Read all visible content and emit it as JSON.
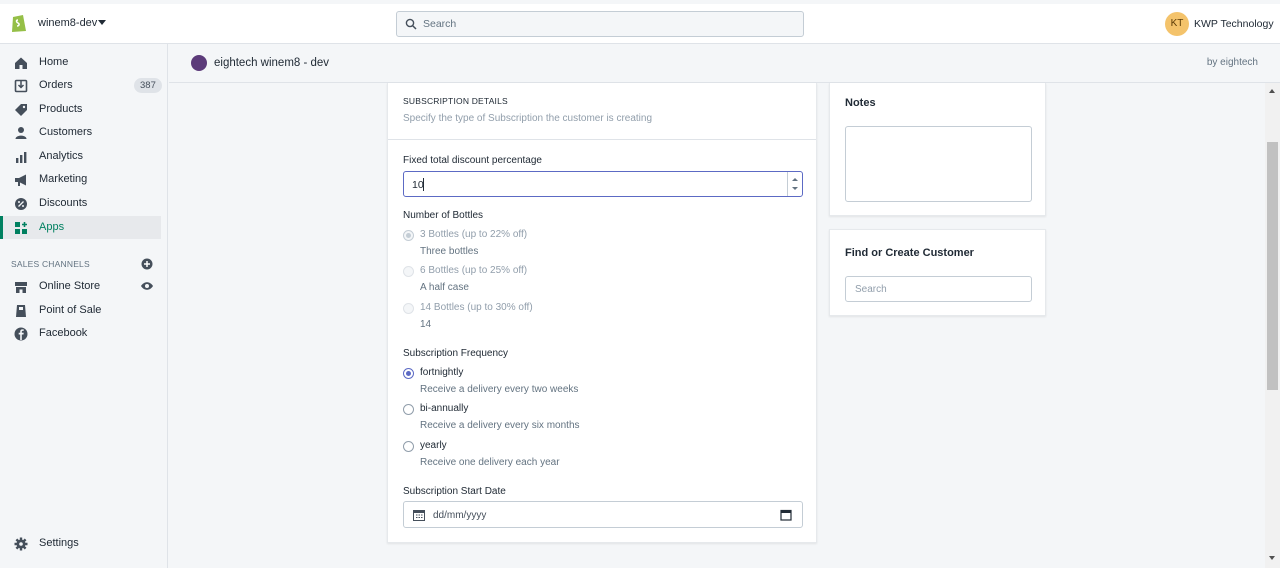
{
  "topbar": {
    "store_name": "winem8-dev",
    "search_placeholder": "Search",
    "avatar_initials": "KT",
    "account_name": "KWP Technology"
  },
  "sidebar": {
    "items": [
      {
        "label": "Home",
        "icon": "home-icon"
      },
      {
        "label": "Orders",
        "icon": "orders-icon",
        "badge": "387"
      },
      {
        "label": "Products",
        "icon": "tag-icon"
      },
      {
        "label": "Customers",
        "icon": "person-icon"
      },
      {
        "label": "Analytics",
        "icon": "bar-chart-icon"
      },
      {
        "label": "Marketing",
        "icon": "megaphone-icon"
      },
      {
        "label": "Discounts",
        "icon": "discount-icon"
      },
      {
        "label": "Apps",
        "icon": "apps-icon",
        "active": true
      }
    ],
    "sales_channels_title": "SALES CHANNELS",
    "channels": [
      {
        "label": "Online Store",
        "icon": "store-icon"
      },
      {
        "label": "Point of Sale",
        "icon": "pos-icon"
      },
      {
        "label": "Facebook",
        "icon": "facebook-icon"
      }
    ],
    "settings_label": "Settings"
  },
  "app_header": {
    "title": "eightech winem8 - dev",
    "by": "by eightech"
  },
  "form": {
    "heading": "SUBSCRIPTION DETAILS",
    "subheading": "Specify the type of Subscription the customer is creating",
    "discount_label": "Fixed total discount percentage",
    "discount_value": "10",
    "bottles_label": "Number of Bottles",
    "bottles": [
      {
        "label": "3 Bottles (up to 22% off)",
        "help": "Three bottles",
        "checked": true,
        "disabled": true
      },
      {
        "label": "6 Bottles (up to 25% off)",
        "help": "A half case",
        "checked": false,
        "disabled": true
      },
      {
        "label": "14 Bottles (up to 30% off)",
        "help": "14",
        "checked": false,
        "disabled": true
      }
    ],
    "frequency_label": "Subscription Frequency",
    "frequencies": [
      {
        "label": "fortnightly",
        "help": "Receive a delivery every two weeks",
        "checked": true
      },
      {
        "label": "bi-annually",
        "help": "Receive a delivery every six months",
        "checked": false
      },
      {
        "label": "yearly",
        "help": "Receive one delivery each year",
        "checked": false
      }
    ],
    "start_date_label": "Subscription Start Date",
    "start_date_placeholder": "dd/mm/yyyy"
  },
  "notes": {
    "title": "Notes"
  },
  "customer": {
    "title": "Find or Create Customer",
    "search_placeholder": "Search"
  },
  "colors": {
    "accent": "#5c6ac4",
    "active_nav": "#008060",
    "avatar": "#f4c36b"
  }
}
